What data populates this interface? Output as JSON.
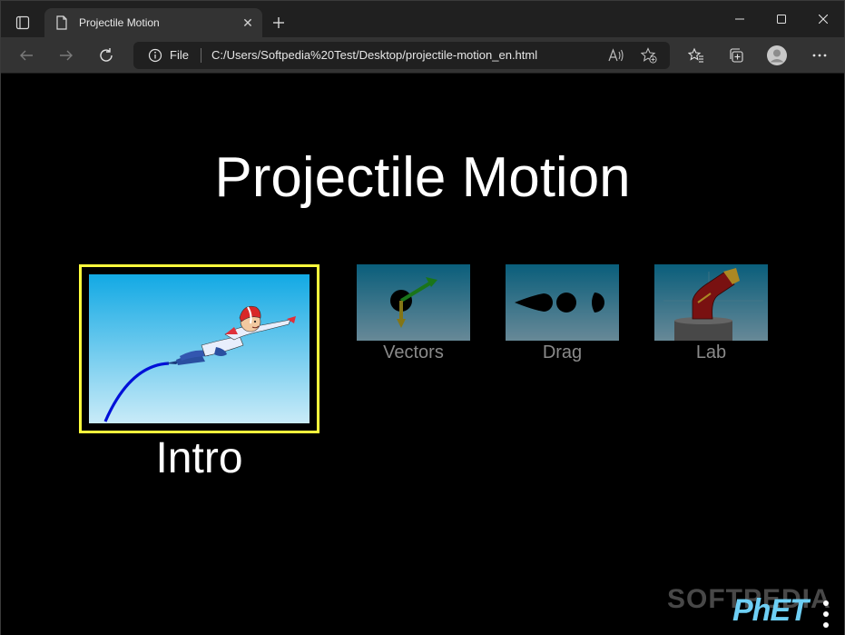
{
  "browser": {
    "tab": {
      "title": "Projectile Motion",
      "close_icon": "close-icon"
    },
    "address_bar": {
      "scheme_label": "File",
      "url": "C:/Users/Softpedia%20Test/Desktop/projectile-motion_en.html"
    },
    "window_controls": [
      "minimize",
      "maximize",
      "close"
    ]
  },
  "sim": {
    "title": "Projectile Motion",
    "screens": [
      {
        "label": "Intro",
        "selected": true
      },
      {
        "label": "Vectors",
        "selected": false
      },
      {
        "label": "Drag",
        "selected": false
      },
      {
        "label": "Lab",
        "selected": false
      }
    ],
    "watermark": "SOFTPEDIA",
    "logo": "PhET"
  },
  "colors": {
    "selection_border": "#ffff3c",
    "background": "#000000",
    "title_text": "#ffffff",
    "inactive_label": "#8a8a8a"
  }
}
